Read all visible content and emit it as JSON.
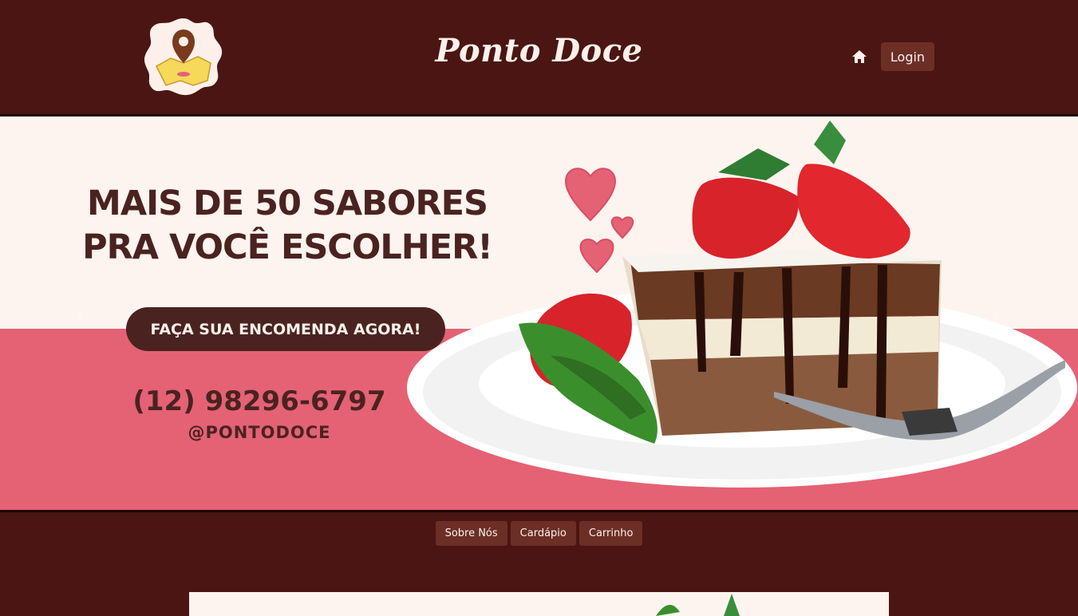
{
  "header": {
    "brand": "Ponto Doce",
    "login_label": "Login",
    "home_icon": "home-icon",
    "logo_icon": "donut-map-pin-logo"
  },
  "banner": {
    "headline_line1": "MAIS DE 50 SABORES",
    "headline_line2": "PRA VOCÊ  ESCOLHER!",
    "cta_label": "FAÇA SUA ENCOMENDA AGORA!",
    "phone": "(12) 98296-6797",
    "handle": "@PONTODOCE",
    "prev_label": "‹",
    "next_label": "›"
  },
  "nav": {
    "items": [
      {
        "label": "Sobre Nós"
      },
      {
        "label": "Cardápio"
      },
      {
        "label": "Carrinho"
      }
    ]
  },
  "colors": {
    "background": "#4a1512",
    "banner_top": "#fdf4ef",
    "banner_bottom": "#e46274",
    "button": "#6b2f26",
    "text_dark": "#4a2320"
  }
}
